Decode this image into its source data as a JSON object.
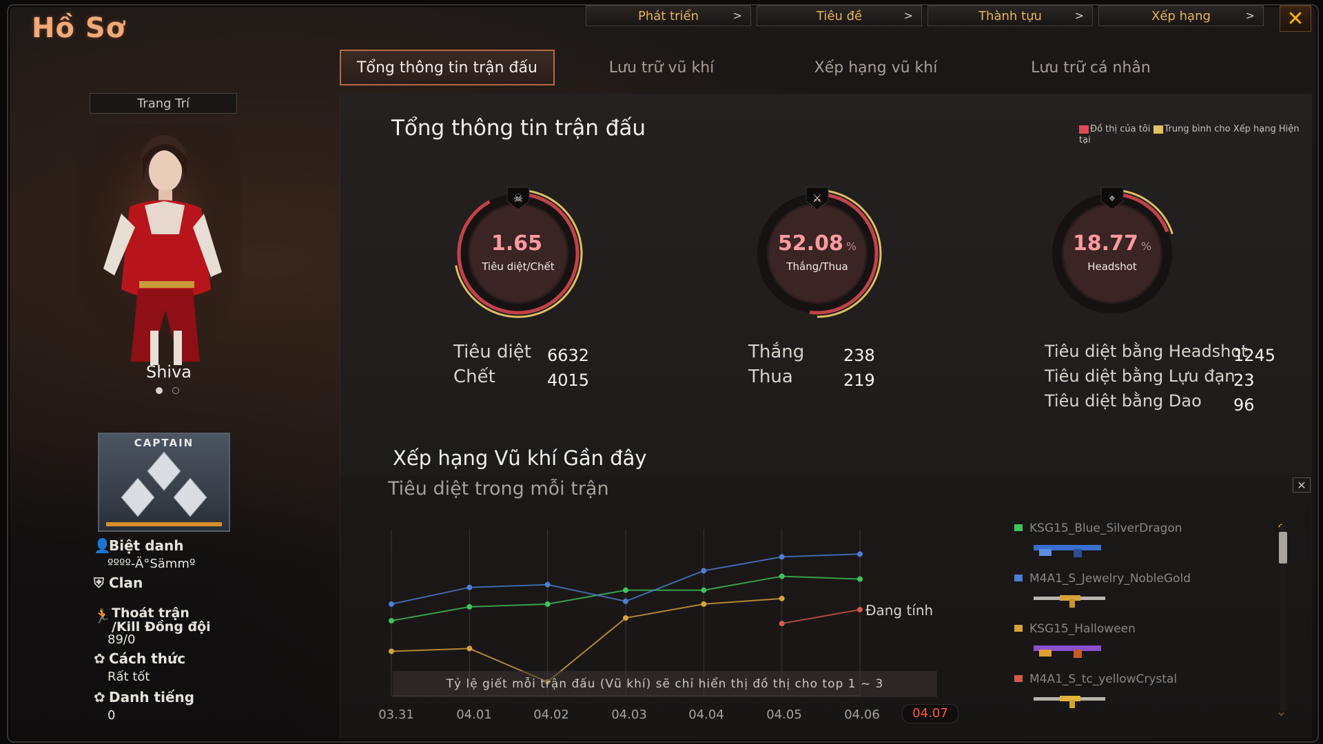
{
  "window": {
    "title": "Hồ Sơ"
  },
  "top_nav": [
    {
      "label": "Phát triển"
    },
    {
      "label": "Tiêu đề"
    },
    {
      "label": "Thành tựu"
    },
    {
      "label": "Xếp hạng"
    }
  ],
  "chevron": ">",
  "close_glyph": "✕",
  "tabs": [
    {
      "label": "Tổng thông tin trận đấu",
      "active": true
    },
    {
      "label": "Lưu trữ vũ khí"
    },
    {
      "label": "Xếp hạng vũ khí"
    },
    {
      "label": "Lưu trữ cá nhân"
    }
  ],
  "left": {
    "decorate_button": "Trang Trí",
    "character_name": "Shiva",
    "rank_badge_text": "CAPTAIN",
    "nickname_label": "Biệt danh",
    "nickname_value": "ºººº-Ä°Sämmº",
    "clan_label": "Clan",
    "quit_label_1": "Thoát trận",
    "quit_label_2": "/Kill Đồng đội",
    "quit_value": "89/0",
    "style_label": "Cách thức",
    "style_value": "Rất tốt",
    "reputation_label": "Danh tiếng",
    "reputation_value": "0"
  },
  "summary": {
    "title": "Tổng thông tin trận đấu",
    "legend_mine": "Đồ thị của tôi",
    "legend_avg": "Trung bình cho Xếp hạng Hiện tại",
    "colors": {
      "mine": "#e04a55",
      "avg": "#e0c060"
    },
    "dials": [
      {
        "value": "1.65",
        "unit": "",
        "label": "Tiêu diệt/Chết",
        "icon": "skull-crossbones-icon",
        "fill": 0.92,
        "avg_fill": 0.72
      },
      {
        "value": "52.08",
        "unit": "%",
        "label": "Thắng/Thua",
        "icon": "crossed-swords-icon",
        "fill": 0.52,
        "avg_fill": 0.5
      },
      {
        "value": "18.77",
        "unit": "%",
        "label": "Headshot",
        "icon": "crosshair-icon",
        "fill": 0.19,
        "avg_fill": 0.2
      }
    ],
    "stats": {
      "kills_label": "Tiêu diệt",
      "kills_value": "6632",
      "deaths_label": "Chết",
      "deaths_value": "4015",
      "wins_label": "Thắng",
      "wins_value": "238",
      "losses_label": "Thua",
      "losses_value": "219",
      "hs_kills_label": "Tiêu diệt bằng Headshot",
      "hs_kills_value": "1245",
      "grenade_kills_label": "Tiêu diệt bằng Lựu đạn",
      "grenade_kills_value": "23",
      "knife_kills_label": "Tiêu diệt bằng Dao",
      "knife_kills_value": "96"
    }
  },
  "weapon_rank": {
    "title": "Xếp hạng Vũ khí Gần đây",
    "subtitle": "Tiêu diệt trong mỗi trận",
    "calculating_label": "Đang tính",
    "note": "Tỷ lệ giết mỗi trận đấu (Vũ khí) sẽ chỉ hiển thị đồ thị cho top 1 ~ 3",
    "weapons": [
      {
        "name": "KSG15_Blue_SilverDragon",
        "color": "#3ec45a"
      },
      {
        "name": "M4A1_S_Jewelry_NobleGold",
        "color": "#4a7fd6"
      },
      {
        "name": "KSG15_Halloween",
        "color": "#d9a33a"
      },
      {
        "name": "M4A1_S_tc_yellowCrystal",
        "color": "#d65a4a"
      }
    ]
  },
  "chart_data": {
    "type": "line",
    "x": [
      "03.31",
      "04.01",
      "04.02",
      "04.03",
      "04.04",
      "04.05",
      "04.06",
      "04.07"
    ],
    "series": [
      {
        "name": "KSG15_Blue_SilverDragon",
        "color": "#3ec45a",
        "values": [
          2.7,
          3.2,
          3.3,
          3.8,
          3.8,
          4.3,
          4.2,
          null
        ]
      },
      {
        "name": "M4A1_S_Jewelry_NobleGold",
        "color": "#4a7fd6",
        "values": [
          3.3,
          3.9,
          4.0,
          3.4,
          4.5,
          5.0,
          5.1,
          null
        ]
      },
      {
        "name": "KSG15_Halloween",
        "color": "#d9a33a",
        "values": [
          1.6,
          1.7,
          0.5,
          2.8,
          3.3,
          3.5,
          null,
          null
        ]
      },
      {
        "name": "M4A1_S_tc_yellowCrystal",
        "color": "#d65a4a",
        "values": [
          null,
          null,
          null,
          null,
          null,
          2.6,
          3.1,
          null
        ]
      }
    ],
    "ylim": [
      0,
      6
    ],
    "grid": true,
    "active_x": "04.07"
  }
}
